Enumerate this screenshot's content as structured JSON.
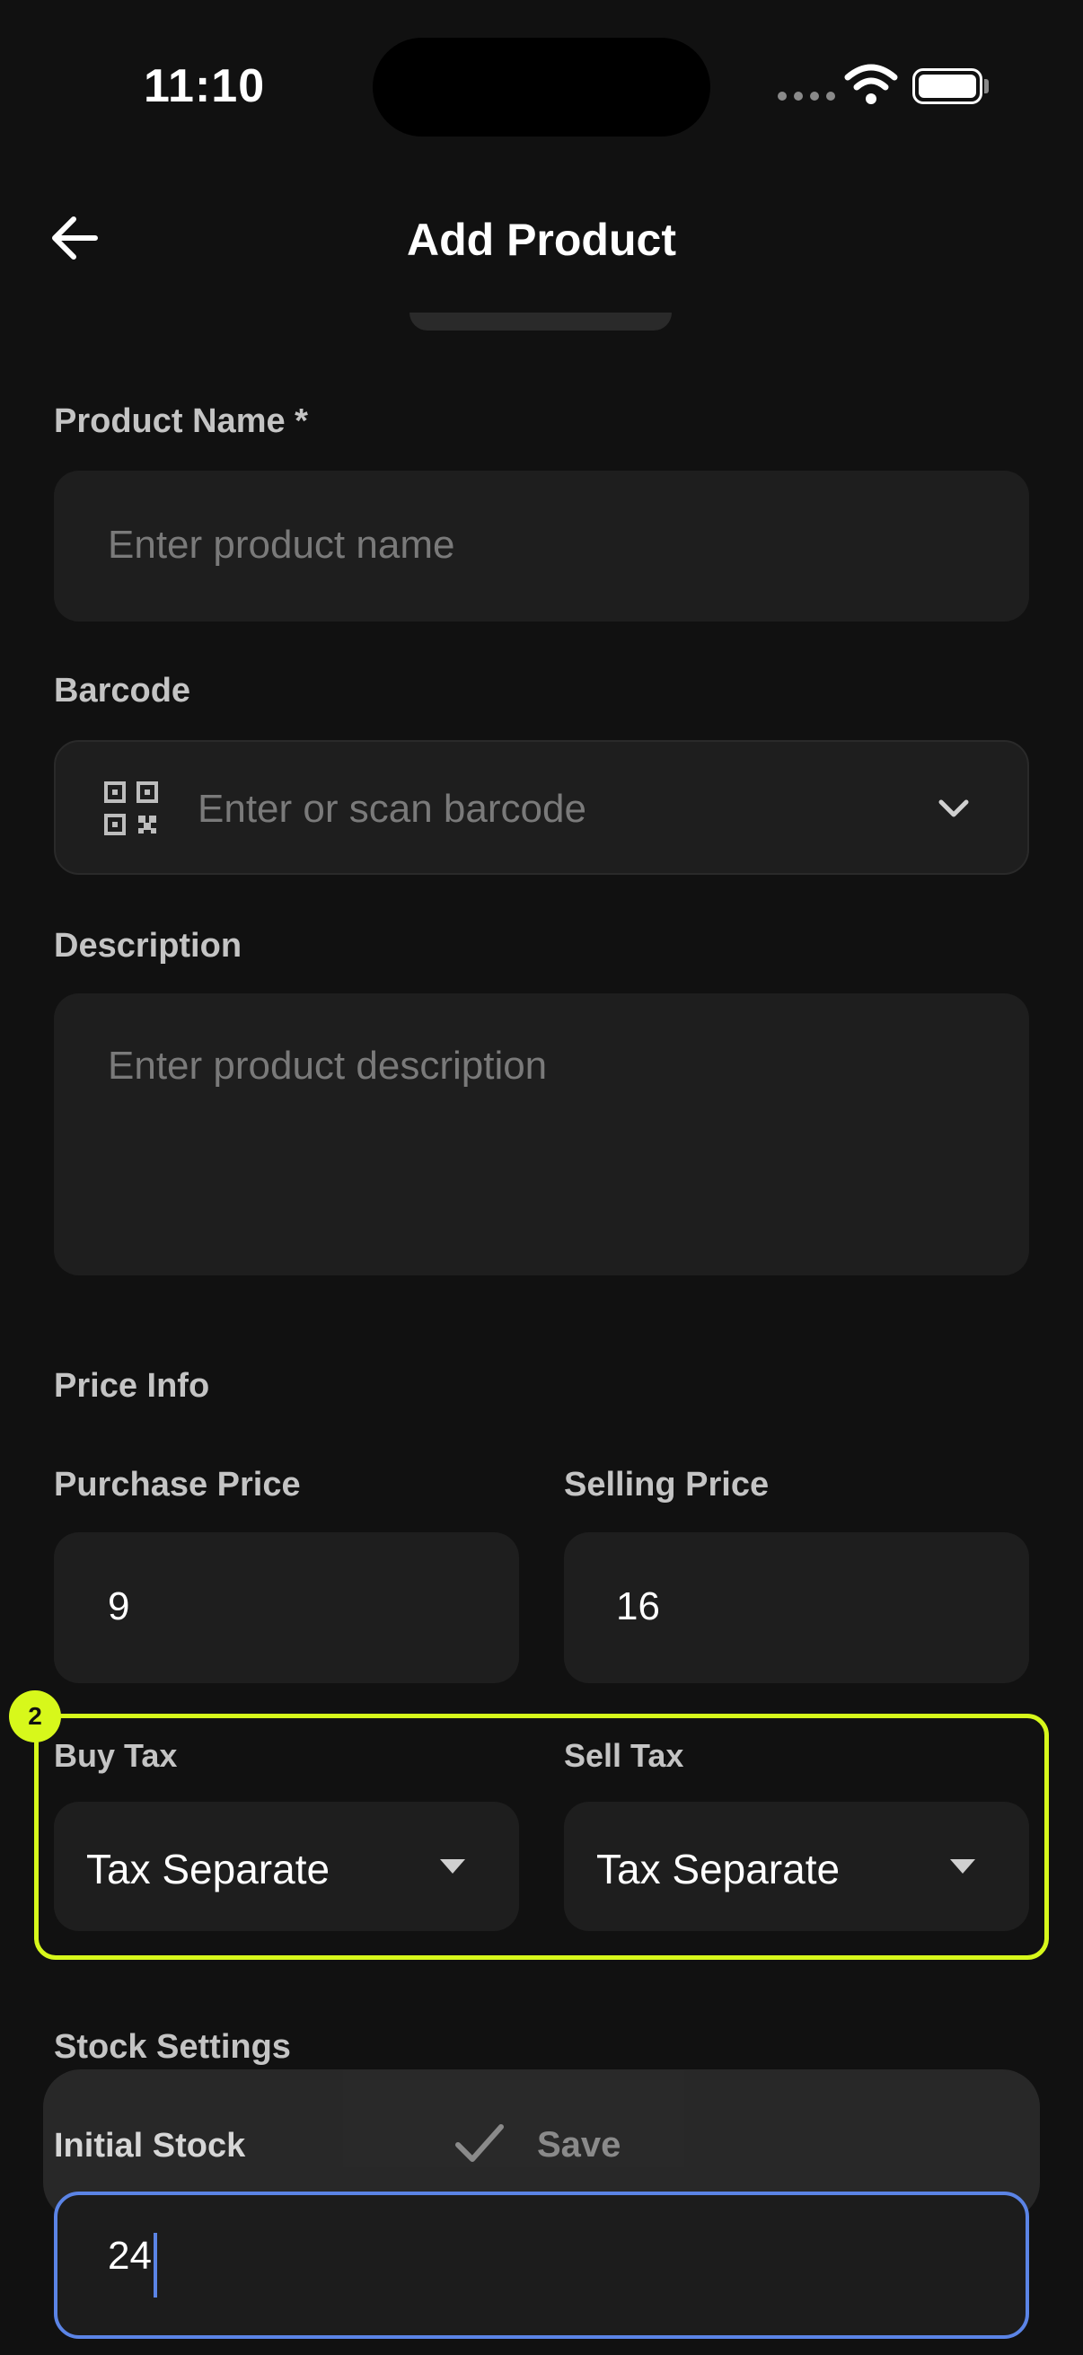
{
  "status_bar": {
    "time": "11:10"
  },
  "header": {
    "title": "Add Product",
    "back_icon": "arrow-left-icon"
  },
  "form": {
    "product_name": {
      "label": "Product Name *",
      "placeholder": "Enter product name",
      "value": ""
    },
    "barcode": {
      "label": "Barcode",
      "placeholder": "Enter or scan barcode",
      "icon": "qr-scan-icon",
      "dropdown_icon": "chevron-down-icon"
    },
    "description": {
      "label": "Description",
      "placeholder": "Enter product description"
    },
    "price_info": {
      "section_title": "Price Info",
      "purchase_price": {
        "label": "Purchase Price",
        "value": "9"
      },
      "selling_price": {
        "label": "Selling Price",
        "value": "16"
      }
    },
    "tax": {
      "buy_tax": {
        "label": "Buy Tax",
        "selected": "Tax Separate"
      },
      "sell_tax": {
        "label": "Sell Tax",
        "selected": "Tax Separate"
      },
      "highlight_badge": "2",
      "highlight_color": "#d7f81b"
    },
    "stock": {
      "section_title": "Stock Settings",
      "initial_stock": {
        "label": "Initial Stock",
        "value": "24"
      }
    }
  },
  "save_button": {
    "label": "Save",
    "icon": "checkmark-icon"
  },
  "colors": {
    "background": "#111111",
    "field": "#1e1e1e",
    "focus": "#5b84e6",
    "accent": "#d7f81b"
  }
}
